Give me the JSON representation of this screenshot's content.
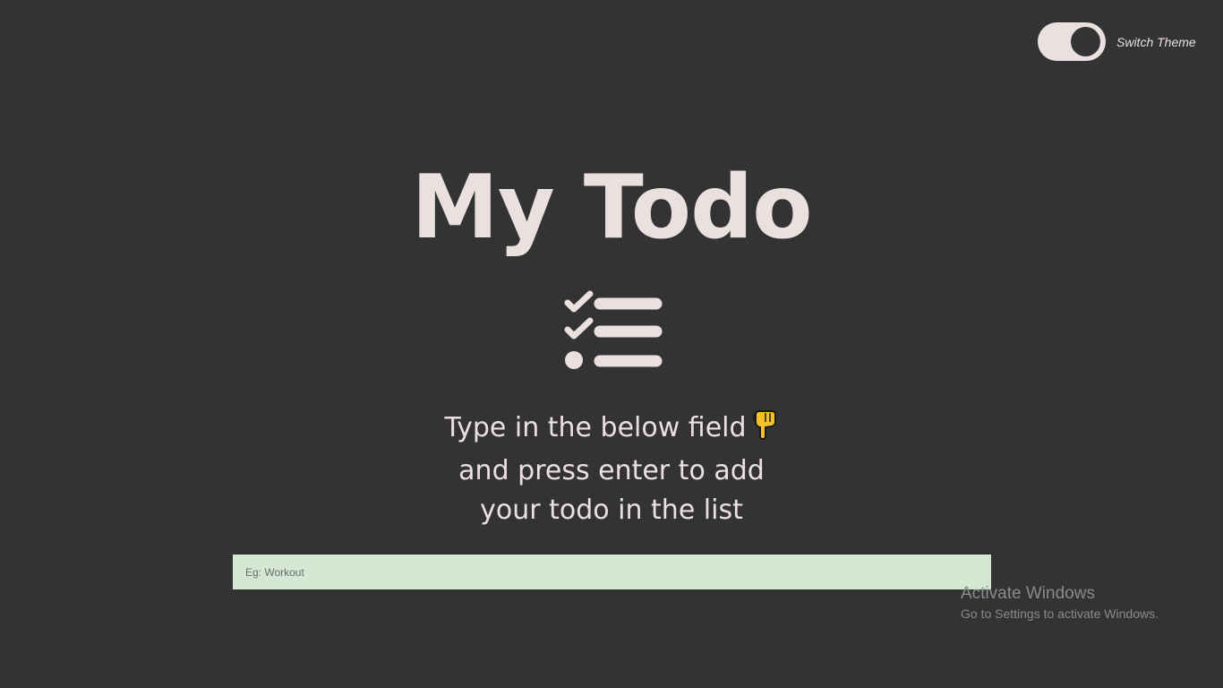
{
  "theme_switch": {
    "label": "Switch Theme",
    "state": "dark"
  },
  "header": {
    "title": "My Todo"
  },
  "icons": {
    "list": "checklist-icon",
    "hand": "pointing-down-hand-icon"
  },
  "instructions": {
    "line1": "Type in the below field",
    "line2": "and press enter to add",
    "line3": "your todo in the list"
  },
  "todo_input": {
    "placeholder": "Eg: Workout",
    "value": ""
  },
  "watermark": {
    "title": "Activate Windows",
    "subtitle": "Go to Settings to activate Windows."
  },
  "colors": {
    "background": "#333333",
    "foreground": "#ebe0e0",
    "input_background": "#d4e8d4"
  }
}
